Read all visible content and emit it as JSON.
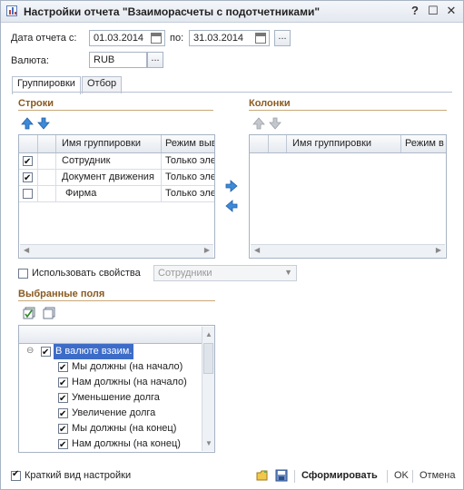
{
  "window": {
    "title": "Настройки отчета \"Взаиморасчеты с подотчетниками\"",
    "help_label": "?",
    "close_label": "✕",
    "restore_label": "☐"
  },
  "dates": {
    "from_label": "Дата отчета с:",
    "from_value": "01.03.2014",
    "to_label": "по:",
    "to_value": "31.03.2014",
    "more_label": "..."
  },
  "currency": {
    "label": "Валюта:",
    "value": "RUB",
    "more_label": "..."
  },
  "tabs": [
    {
      "label": "Группировки",
      "active": true
    },
    {
      "label": "Отбор",
      "active": false
    }
  ],
  "rows_section": {
    "title": "Строки",
    "columns": [
      "Имя группировки",
      "Режим выв"
    ],
    "items": [
      {
        "checked": true,
        "name": "Сотрудник",
        "mode": "Только эле"
      },
      {
        "checked": true,
        "name": "Документ движения",
        "mode": "Только эле"
      },
      {
        "checked": false,
        "name": "Фирма",
        "mode": "Только эле"
      }
    ]
  },
  "columns_section": {
    "title": "Колонки",
    "columns": [
      "Имя группировки",
      "Режим в"
    ]
  },
  "use_properties": {
    "label": "Использовать свойства",
    "checked": false,
    "combo_value": "Сотрудники"
  },
  "selected_fields": {
    "title": "Выбранные поля",
    "root": {
      "label": "В валюте взаим.",
      "checked": true
    },
    "items": [
      {
        "label": "Мы должны (на начало)",
        "checked": true
      },
      {
        "label": "Нам должны (на начало)",
        "checked": true
      },
      {
        "label": "Уменьшение долга",
        "checked": true
      },
      {
        "label": "Увеличение долга",
        "checked": true
      },
      {
        "label": "Мы должны (на конец)",
        "checked": true
      },
      {
        "label": "Нам должны (на конец)",
        "checked": true
      }
    ]
  },
  "footer": {
    "brief_label": "Краткий вид настройки",
    "brief_checked": true,
    "generate_label": "Сформировать",
    "ok_label": "OK",
    "cancel_label": "Отмена"
  },
  "colors": {
    "accent": "#3d6cc8",
    "section_title": "#8a5a20",
    "arrow_blue": "#3d8ad8"
  }
}
